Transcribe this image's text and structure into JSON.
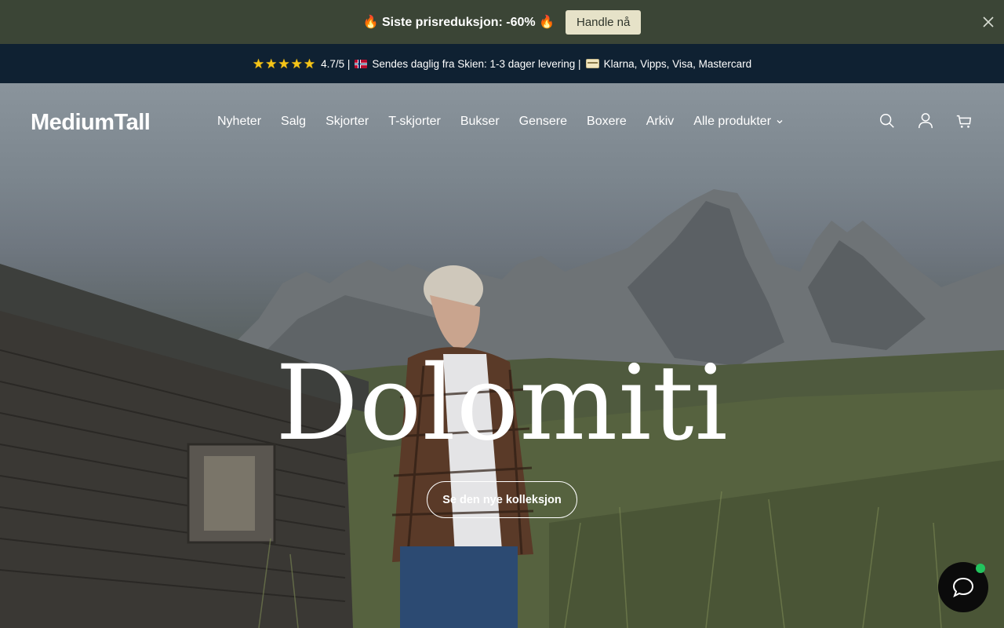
{
  "announcement": {
    "text": "🔥 Siste prisreduksjon: -60% 🔥",
    "button_label": "Handle nå"
  },
  "infobar": {
    "rating": "4.7/5 |",
    "shipping": "Sendes daglig fra Skien: 1-3 dager levering |",
    "payments": "Klarna, Vipps, Visa, Mastercard",
    "star_count": 5
  },
  "header": {
    "logo": "MediumTall",
    "nav": [
      "Nyheter",
      "Salg",
      "Skjorter",
      "T-skjorter",
      "Bukser",
      "Gensere",
      "Boxere",
      "Arkiv",
      "Alle produkter"
    ],
    "icons": [
      "search-icon",
      "account-icon",
      "cart-icon"
    ]
  },
  "hero": {
    "headline": "Dolomiti",
    "cta_label": "Se den nye kolleksjon"
  },
  "colors": {
    "announcement_bg": "#3b4536",
    "infobar_bg": "#0f2132",
    "button_bg": "#e6e2c8",
    "chat_bg": "#0b0b0b",
    "online_dot": "#22c55e"
  }
}
